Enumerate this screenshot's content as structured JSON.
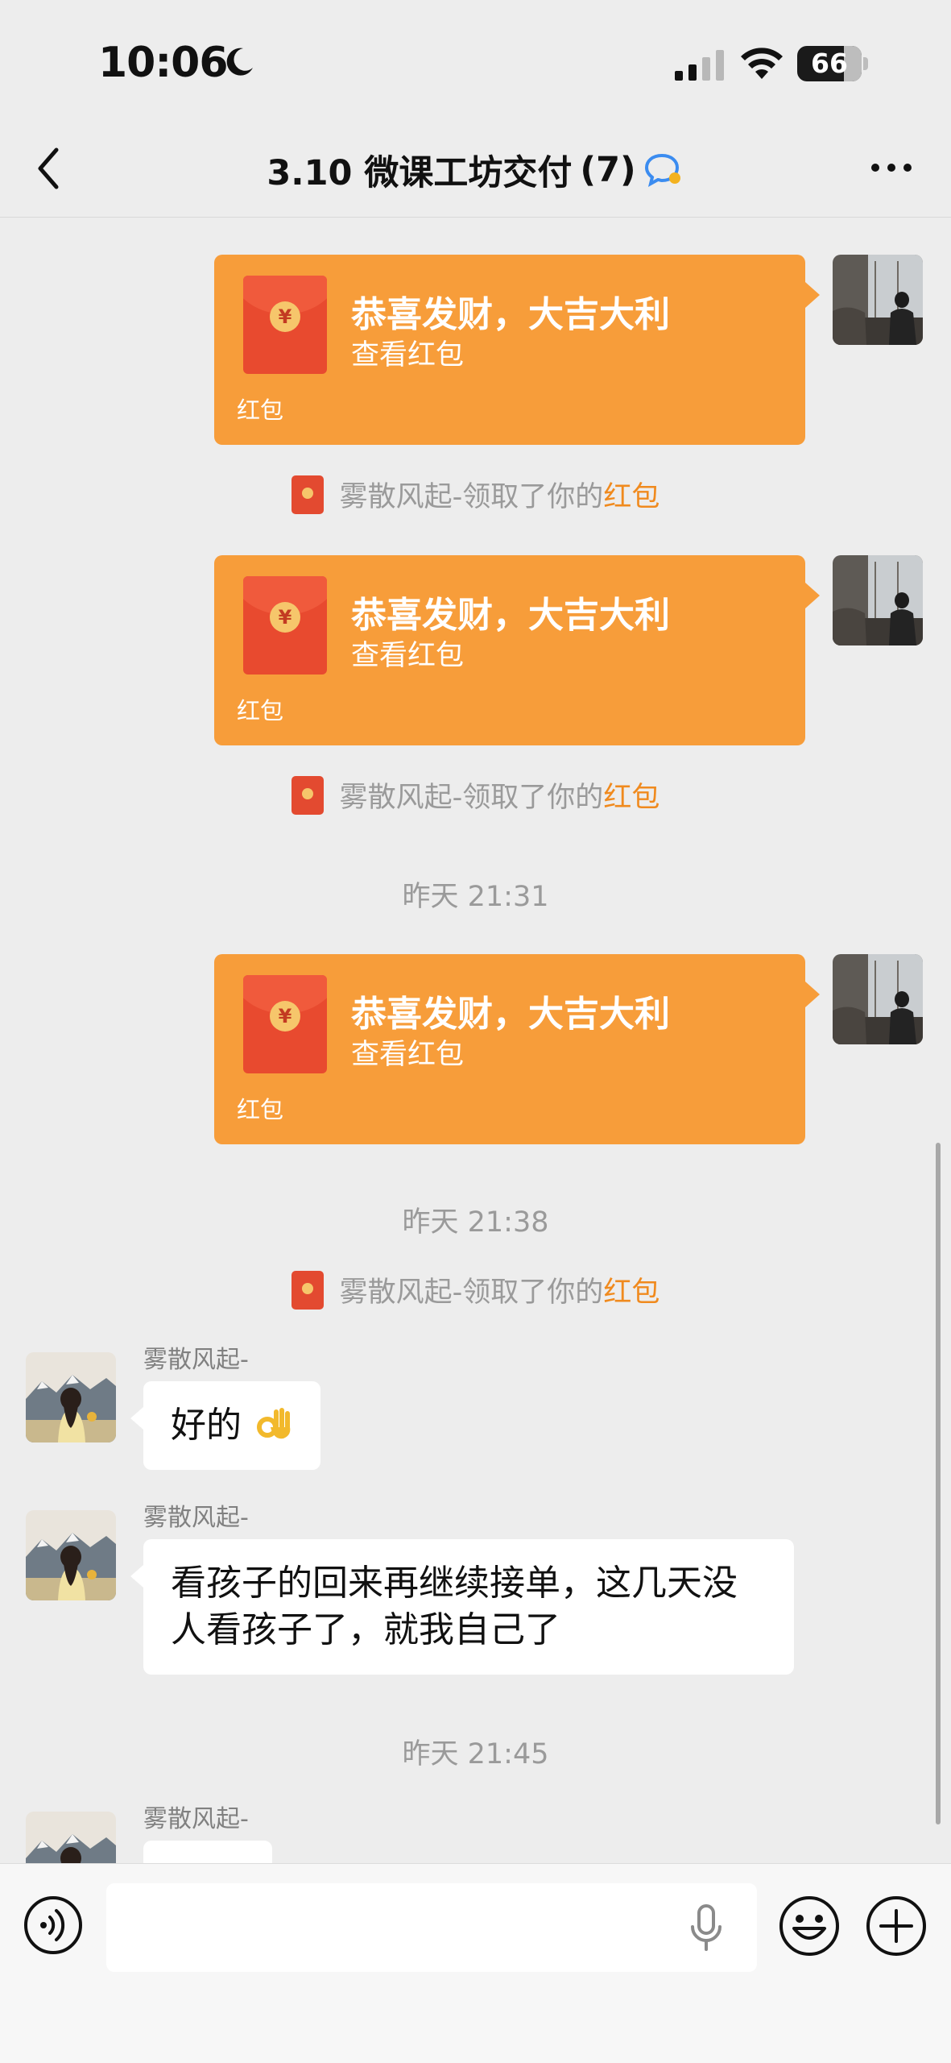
{
  "status_bar": {
    "time": "10:06",
    "battery": "66"
  },
  "nav": {
    "title": "3.10 微课工坊交付",
    "member_count": "(7)"
  },
  "messages": {
    "red_packets": [
      {
        "title": "恭喜发财，大吉大利",
        "subtitle": "查看红包",
        "footer": "红包"
      },
      {
        "title": "恭喜发财，大吉大利",
        "subtitle": "查看红包",
        "footer": "红包"
      },
      {
        "title": "恭喜发财，大吉大利",
        "subtitle": "查看红包",
        "footer": "红包"
      }
    ],
    "system_notices": [
      {
        "text": "雾散风起-领取了你的",
        "link": "红包"
      },
      {
        "text": "雾散风起-领取了你的",
        "link": "红包"
      },
      {
        "text": "雾散风起-领取了你的",
        "link": "红包"
      }
    ],
    "timestamps": [
      "昨天 21:31",
      "昨天 21:38",
      "昨天 21:45"
    ],
    "incoming": [
      {
        "sender": "雾散风起-",
        "text": "好的"
      },
      {
        "sender": "雾散风起-",
        "text": "看孩子的回来再继续接单，这几天没人看孩子了，就我自己了"
      },
      {
        "sender": "雾散风起-",
        "text": ""
      }
    ]
  },
  "input_bar": {
    "placeholder": ""
  },
  "colors": {
    "red_packet": "#f79d3a",
    "link": "#f08a1e",
    "background": "#ededed"
  }
}
